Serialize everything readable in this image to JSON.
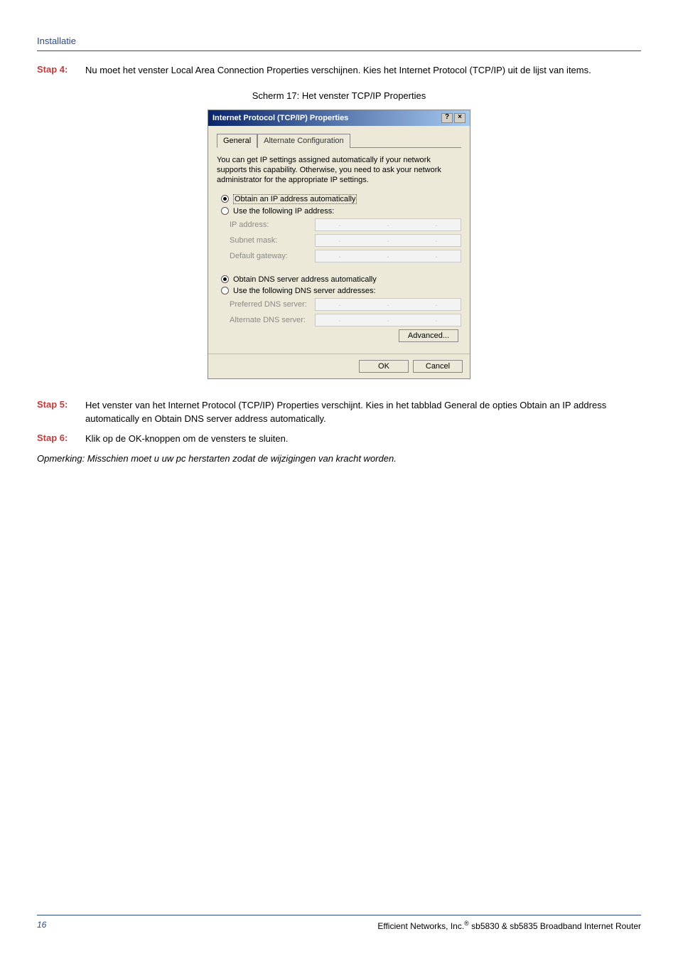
{
  "section_title": "Installatie",
  "steps": {
    "s4": {
      "label": "Stap 4:",
      "text": "Nu moet het venster Local Area Connection Properties verschijnen. Kies het Internet Protocol (TCP/IP) uit de lijst van items."
    },
    "s5": {
      "label": "Stap 5:",
      "text": "Het venster van het Internet Protocol (TCP/IP) Properties verschijnt. Kies in het tabblad General de opties Obtain an IP address automatically en Obtain DNS server address automatically."
    },
    "s6": {
      "label": "Stap 6:",
      "text": "Klik op de OK-knoppen om de vensters te sluiten."
    }
  },
  "caption": "Scherm 17: Het venster TCP/IP Properties",
  "note": "Opmerking: Misschien moet u uw pc herstarten zodat de wijzigingen van kracht worden.",
  "dialog": {
    "title": "Internet Protocol (TCP/IP) Properties",
    "help_btn": "?",
    "close_btn": "×",
    "tabs": {
      "general": "General",
      "alt": "Alternate Configuration"
    },
    "desc": "You can get IP settings assigned automatically if your network supports this capability. Otherwise, you need to ask your network administrator for the appropriate IP settings.",
    "radios": {
      "obtain_ip": "Obtain an IP address automatically",
      "use_ip": "Use the following IP address:",
      "obtain_dns": "Obtain DNS server address automatically",
      "use_dns": "Use the following DNS server addresses:"
    },
    "fields": {
      "ip": "IP address:",
      "subnet": "Subnet mask:",
      "gateway": "Default gateway:",
      "pref_dns": "Preferred DNS server:",
      "alt_dns": "Alternate DNS server:"
    },
    "advanced": "Advanced...",
    "ok": "OK",
    "cancel": "Cancel"
  },
  "footer": {
    "page_num": "16",
    "text_left": "Efficient Networks, Inc.",
    "reg": "®",
    "text_right": " sb5830 & sb5835 Broadband Internet Router"
  }
}
